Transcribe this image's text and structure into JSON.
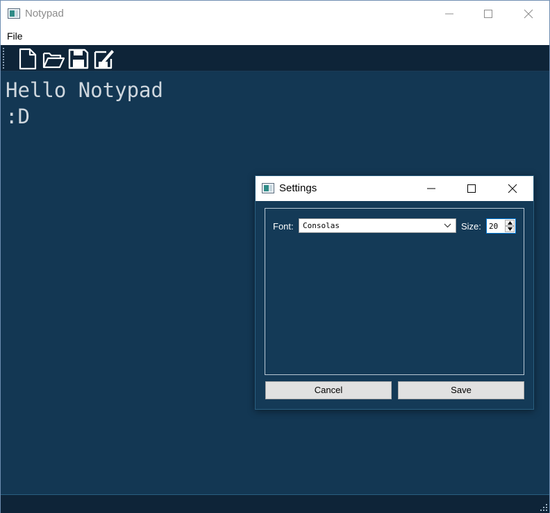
{
  "window": {
    "title": "Notypad"
  },
  "menu": {
    "items": [
      {
        "label": "File"
      }
    ]
  },
  "toolbar": {
    "tools": [
      {
        "name": "new",
        "icon": "new-file-icon"
      },
      {
        "name": "open",
        "icon": "open-folder-icon"
      },
      {
        "name": "save",
        "icon": "save-icon"
      },
      {
        "name": "save-as",
        "icon": "save-as-icon"
      }
    ]
  },
  "editor": {
    "lines": [
      "Hello Notypad",
      ":D"
    ]
  },
  "settings": {
    "title": "Settings",
    "font_label": "Font:",
    "font_value": "Consolas",
    "size_label": "Size:",
    "size_value": "20",
    "cancel_label": "Cancel",
    "save_label": "Save"
  },
  "colors": {
    "editor_bg": "#133753",
    "toolbar_bg": "#0e2438",
    "text": "#cfd7de",
    "dialog_bg": "#143a57"
  }
}
